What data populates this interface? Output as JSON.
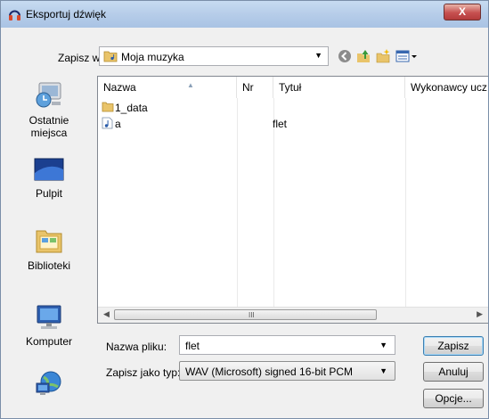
{
  "window": {
    "title": "Eksportuj dźwięk",
    "close_label": "X"
  },
  "toolbar": {
    "save_in_label": "Zapisz w:",
    "save_in_value": "Moja muzyka",
    "icons": [
      "back-icon",
      "up-folder-icon",
      "new-folder-icon",
      "view-menu-icon"
    ]
  },
  "places": [
    {
      "label_line1": "Ostatnie",
      "label_line2": "miejsca",
      "icon": "recent-places-icon"
    },
    {
      "label_line1": "Pulpit",
      "label_line2": "",
      "icon": "desktop-icon"
    },
    {
      "label_line1": "Biblioteki",
      "label_line2": "",
      "icon": "libraries-icon"
    },
    {
      "label_line1": "Komputer",
      "label_line2": "",
      "icon": "computer-icon"
    },
    {
      "label_line1": "",
      "label_line2": "",
      "icon": "network-icon"
    }
  ],
  "columns": [
    "Nazwa",
    "Nr",
    "Tytuł",
    "Wykonawcy ucz"
  ],
  "files": [
    {
      "name": "1_data",
      "title": "",
      "icon": "folder-icon"
    },
    {
      "name": "a",
      "title": "flet",
      "icon": "audio-file-icon"
    }
  ],
  "form": {
    "filename_label": "Nazwa pliku:",
    "filename_value": "flet",
    "type_label": "Zapisz jako typ:",
    "type_value": "WAV (Microsoft) signed 16-bit PCM"
  },
  "buttons": {
    "save": "Zapisz",
    "cancel": "Anuluj",
    "options": "Opcje..."
  },
  "scrollbar": {
    "grip": "III"
  }
}
